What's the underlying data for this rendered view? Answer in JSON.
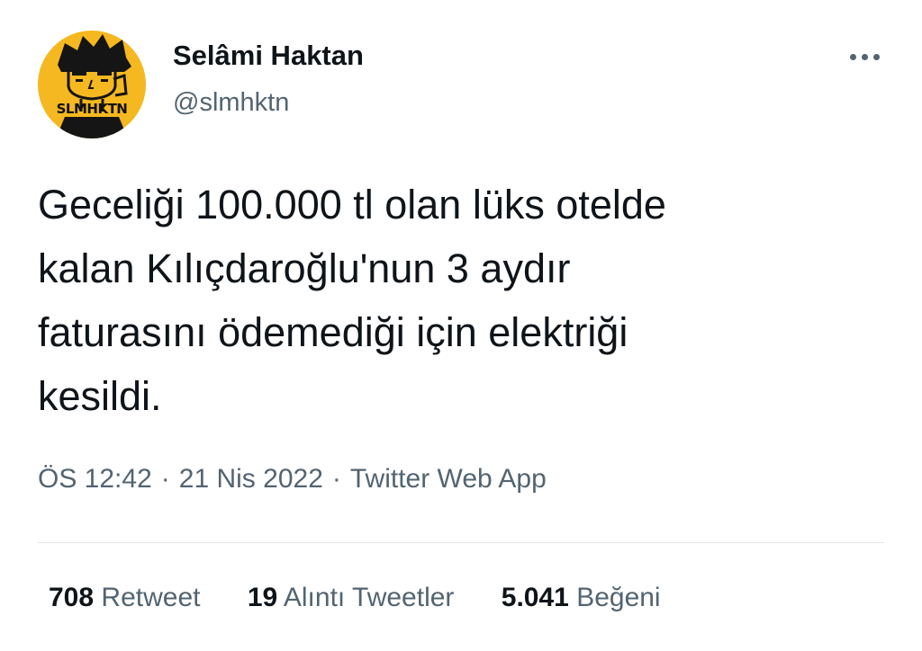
{
  "author": {
    "avatar_text": "SLMHKTN",
    "avatar_bg": "#f5b820",
    "display_name": "Selâmi Haktan",
    "handle": "@slmhktn"
  },
  "menu": {
    "icon": "more-horizontal-icon"
  },
  "tweet": {
    "text": "Geceliği 100.000 tl olan lüks otelde\nkalan Kılıçdaroğlu'nun 3 aydır\nfaturasını ödemediği için elektriği\nkesildi."
  },
  "meta": {
    "time": "ÖS 12:42",
    "separator": "·",
    "date": "21 Nis 2022",
    "source": "Twitter Web App"
  },
  "stats": {
    "retweets": {
      "count": "708",
      "label": "Retweet"
    },
    "quotes": {
      "count": "19",
      "label": "Alıntı Tweetler"
    },
    "likes": {
      "count": "5.041",
      "label": "Beğeni"
    }
  },
  "colors": {
    "text_primary": "#0f1419",
    "text_secondary": "#536471",
    "divider": "#e3e7ea"
  }
}
